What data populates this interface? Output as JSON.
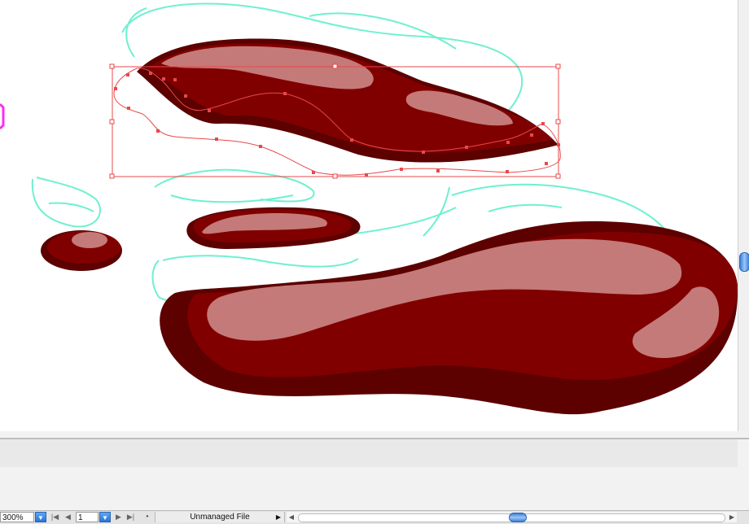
{
  "statusbar": {
    "zoom": "300%",
    "page": "1",
    "status_text": "Unmanaged File",
    "zoom_dropdown_icon": "chevron-down-icon",
    "page_dropdown_icon": "chevron-down-icon",
    "first_icon": "first-page-icon",
    "prev_icon": "prev-page-icon",
    "next_icon": "next-page-icon",
    "last_icon": "last-page-icon",
    "status_icon": "clock-icon"
  },
  "colors": {
    "blob_main": "#800000",
    "blob_shadow": "#5c0000",
    "highlight": "#c47a78",
    "sketch": "#6ff0d0",
    "selection": "#e8484a",
    "scroll_thumb": "#3b7fd8"
  }
}
